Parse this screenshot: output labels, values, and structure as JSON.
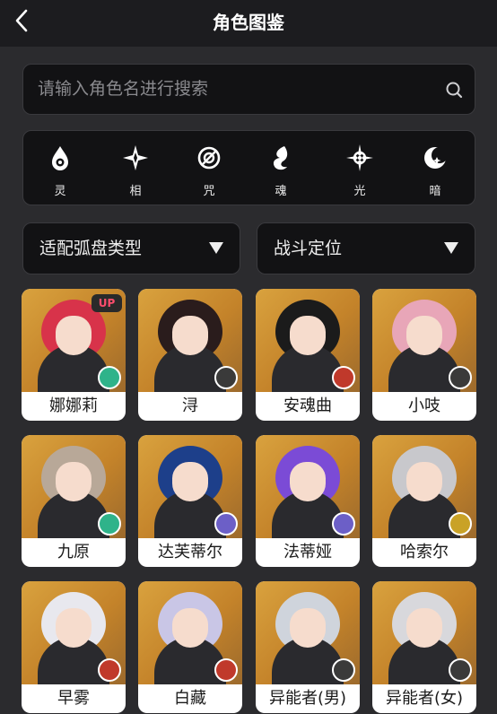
{
  "header": {
    "title": "角色图鉴",
    "back_icon": "chevron-left-icon"
  },
  "search": {
    "placeholder": "请输入角色名进行搜索",
    "icon": "search-icon"
  },
  "filters": [
    {
      "label": "灵",
      "icon": "spirit-drop-icon"
    },
    {
      "label": "相",
      "icon": "phase-star-icon"
    },
    {
      "label": "咒",
      "icon": "curse-ring-icon"
    },
    {
      "label": "魂",
      "icon": "soul-flame-icon"
    },
    {
      "label": "光",
      "icon": "light-burst-icon"
    },
    {
      "label": "暗",
      "icon": "dark-crescent-icon"
    }
  ],
  "dropdowns": [
    {
      "label": "适配弧盘类型",
      "icon": "caret-down-icon"
    },
    {
      "label": "战斗定位",
      "icon": "caret-down-icon"
    }
  ],
  "characters": [
    {
      "name": "娜娜莉",
      "badge": "UP",
      "element_color": "#2fb38a",
      "hair": "#d8334a"
    },
    {
      "name": "浔",
      "badge": "",
      "element_color": "#3a3a3a",
      "hair": "#2a1c1c"
    },
    {
      "name": "安魂曲",
      "badge": "",
      "element_color": "#c0392b",
      "hair": "#1b1b1b"
    },
    {
      "name": "小吱",
      "badge": "",
      "element_color": "#3a3a3a",
      "hair": "#e8a6b8"
    },
    {
      "name": "九原",
      "badge": "",
      "element_color": "#2fb38a",
      "hair": "#b8a898"
    },
    {
      "name": "达芙蒂尔",
      "badge": "",
      "element_color": "#6c5fc7",
      "hair": "#1d3f8a"
    },
    {
      "name": "法蒂娅",
      "badge": "",
      "element_color": "#6c5fc7",
      "hair": "#7b4bd6"
    },
    {
      "name": "哈索尔",
      "badge": "",
      "element_color": "#c9a227",
      "hair": "#c8c8cc"
    },
    {
      "name": "早雾",
      "badge": "",
      "element_color": "#c0392b",
      "hair": "#e8e8ee"
    },
    {
      "name": "白藏",
      "badge": "",
      "element_color": "#c0392b",
      "hair": "#c9c6e6"
    },
    {
      "name": "异能者(男)",
      "badge": "",
      "element_color": "#3a3a3a",
      "hair": "#cfd4dc"
    },
    {
      "name": "异能者(女)",
      "badge": "",
      "element_color": "#3a3a3a",
      "hair": "#d8d8dc"
    }
  ]
}
